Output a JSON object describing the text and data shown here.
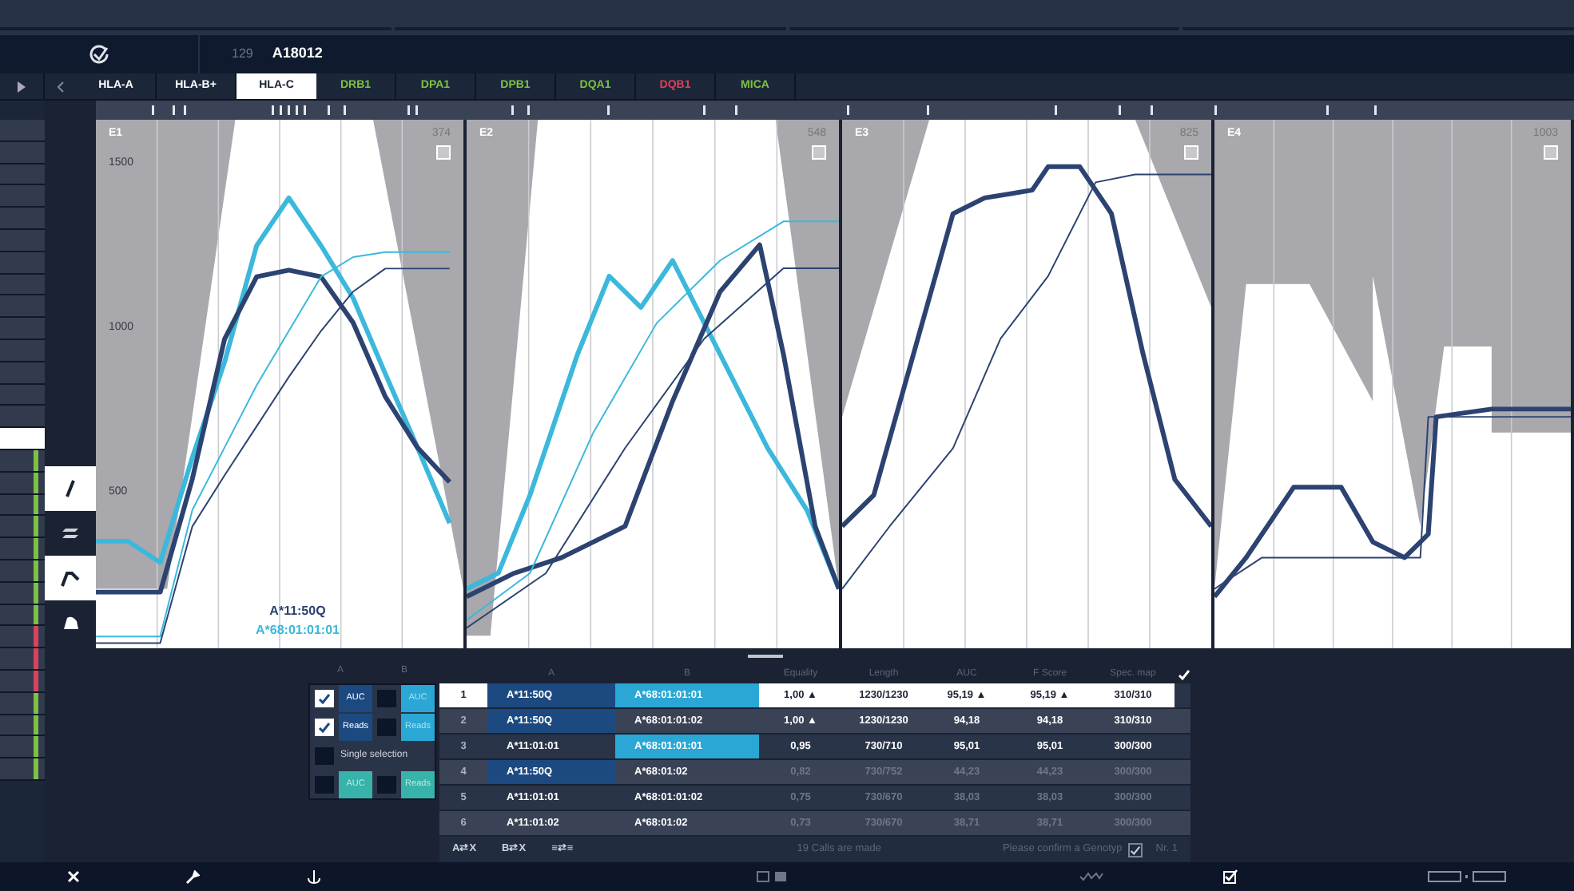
{
  "header": {
    "run_number": "129",
    "sample_id": "A18012"
  },
  "tabs": [
    {
      "label": "HLA-A",
      "selected": false,
      "color": "#ffffff"
    },
    {
      "label": "HLA-B+",
      "selected": false,
      "color": "#ffffff"
    },
    {
      "label": "HLA-C",
      "selected": true,
      "color": "#ffffff"
    },
    {
      "label": "DRB1",
      "selected": false,
      "color": "#7cc242"
    },
    {
      "label": "DPA1",
      "selected": false,
      "color": "#7cc242"
    },
    {
      "label": "DPB1",
      "selected": false,
      "color": "#7cc242"
    },
    {
      "label": "DQA1",
      "selected": false,
      "color": "#7cc242"
    },
    {
      "label": "DQB1",
      "selected": false,
      "color": "#d9425a"
    },
    {
      "label": "MICA",
      "selected": false,
      "color": "#7cc242"
    }
  ],
  "sidebar": {
    "items": [
      {
        "selected": false
      },
      {
        "selected": false
      },
      {
        "selected": false
      },
      {
        "selected": false
      },
      {
        "selected": false
      },
      {
        "selected": false
      },
      {
        "selected": false
      },
      {
        "selected": false
      },
      {
        "selected": false
      },
      {
        "selected": false
      },
      {
        "selected": false
      },
      {
        "selected": false
      },
      {
        "selected": false
      },
      {
        "selected": false
      },
      {
        "selected": true
      },
      {
        "selected": false,
        "color": "#7cc242"
      },
      {
        "selected": false,
        "color": "#7cc242"
      },
      {
        "selected": false,
        "color": "#7cc242"
      },
      {
        "selected": false,
        "color": "#7cc242"
      },
      {
        "selected": false,
        "color": "#7cc242"
      },
      {
        "selected": false,
        "color": "#7cc242"
      },
      {
        "selected": false,
        "color": "#7cc242"
      },
      {
        "selected": false,
        "color": "#7cc242"
      },
      {
        "selected": false,
        "color": "#d9425a"
      },
      {
        "selected": false,
        "color": "#d9425a"
      },
      {
        "selected": false,
        "color": "#d9425a"
      },
      {
        "selected": false,
        "color": "#7cc242"
      },
      {
        "selected": false,
        "color": "#7cc242"
      },
      {
        "selected": false,
        "color": "#7cc242"
      },
      {
        "selected": false,
        "color": "#7cc242"
      }
    ]
  },
  "tools": [
    {
      "kind": "pen",
      "selected": true
    },
    {
      "kind": "layers",
      "selected": false
    },
    {
      "kind": "peak",
      "selected": true
    },
    {
      "kind": "shape",
      "selected": false
    }
  ],
  "panels": [
    {
      "label": "E1",
      "count": "374",
      "checked": false,
      "chart_data": {
        "type": "line",
        "categories": [
          null,
          null,
          null,
          null,
          null,
          null,
          null,
          null,
          null,
          null,
          null,
          null
        ],
        "ylim": [
          24,
          1633
        ],
        "yticks": [
          500,
          1000,
          1500
        ],
        "series": [
          {
            "color": "#3bb8dc",
            "values": [
              350,
              350,
              285,
              605,
              895,
              1250,
              1395,
              1250,
              1090,
              860,
              635,
              405
            ]
          },
          {
            "color": "#2c4371",
            "values": [
              195,
              195,
              195,
              540,
              965,
              1155,
              1175,
              1155,
              1015,
              790,
              635,
              530
            ]
          },
          {
            "color": "#3bb8dc",
            "values": [
              60,
              60,
              60,
              445,
              635,
              825,
              990,
              1155,
              1215,
              1230,
              1230,
              1230
            ]
          },
          {
            "color": "#2c4371",
            "values": [
              40,
              40,
              40,
              395,
              550,
              700,
              850,
              990,
              1110,
              1180,
              1180,
              1180
            ]
          }
        ]
      }
    },
    {
      "label": "E2",
      "count": "548",
      "checked": false
    },
    {
      "label": "E3",
      "count": "825",
      "checked": false
    },
    {
      "label": "E4",
      "count": "1003",
      "checked": false
    }
  ],
  "legend": {
    "allele_a": "A*11:50Q",
    "allele_b": "A*68:01:01:01"
  },
  "options": {
    "columns": [
      "A",
      "B"
    ],
    "rows": [
      {
        "kind": "pair",
        "a_checked": true,
        "a_label": "AUC",
        "b_checked": false,
        "b_label": "AUC"
      },
      {
        "kind": "pair",
        "a_checked": true,
        "a_label": "Reads",
        "b_checked": false,
        "b_label": "Reads"
      },
      {
        "kind": "single",
        "checked": false,
        "label": "Single selection"
      },
      {
        "kind": "teal",
        "a_checked": false,
        "a_label": "AUC",
        "b_checked": false,
        "b_label": "Reads"
      }
    ]
  },
  "table": {
    "columns": [
      "A",
      "B",
      "Equality",
      "Length",
      "AUC",
      "F Score",
      "Spec. map"
    ],
    "rows": [
      {
        "index": "1",
        "a": "A*11:50Q",
        "b": "A*68:01:01:01",
        "equality": "1,00 ▲",
        "length": "1230/1230",
        "auc": "95,19 ▲",
        "fscore": "95,19 ▲",
        "spec": "310/310",
        "selected": true,
        "a_highlight": true,
        "b_highlight": true,
        "dim": false
      },
      {
        "index": "2",
        "a": "A*11:50Q",
        "b": "A*68:01:01:02",
        "equality": "1,00 ▲",
        "length": "1230/1230",
        "auc": "94,18",
        "fscore": "94,18",
        "spec": "310/310",
        "selected": false,
        "a_highlight": true,
        "b_highlight": false,
        "dim": false
      },
      {
        "index": "3",
        "a": "A*11:01:01",
        "b": "A*68:01:01:01",
        "equality": "0,95",
        "length": "730/710",
        "auc": "95,01",
        "fscore": "95,01",
        "spec": "300/300",
        "selected": false,
        "a_highlight": false,
        "b_highlight": true,
        "dim": false
      },
      {
        "index": "4",
        "a": "A*11:50Q",
        "b": "A*68:01:02",
        "equality": "0,82",
        "length": "730/752",
        "auc": "44,23",
        "fscore": "44,23",
        "spec": "300/300",
        "selected": false,
        "a_highlight": true,
        "b_highlight": false,
        "dim": true
      },
      {
        "index": "5",
        "a": "A*11:01:01",
        "b": "A*68:01:01:02",
        "equality": "0,75",
        "length": "730/670",
        "auc": "38,03",
        "fscore": "38,03",
        "spec": "300/300",
        "selected": false,
        "a_highlight": false,
        "b_highlight": false,
        "dim": true
      },
      {
        "index": "6",
        "a": "A*11:01:02",
        "b": "A*68:01:02",
        "equality": "0,73",
        "length": "730/670",
        "auc": "38,71",
        "fscore": "38,71",
        "spec": "300/300",
        "selected": false,
        "a_highlight": false,
        "b_highlight": false,
        "dim": true
      }
    ],
    "actions": [
      "A⇄X",
      "B⇄X",
      "≡⇄≡"
    ],
    "status": "19 Calls are made",
    "confirm": "Please confirm a Genotyp",
    "confirm_checked": true,
    "number": "Nr. 1"
  }
}
